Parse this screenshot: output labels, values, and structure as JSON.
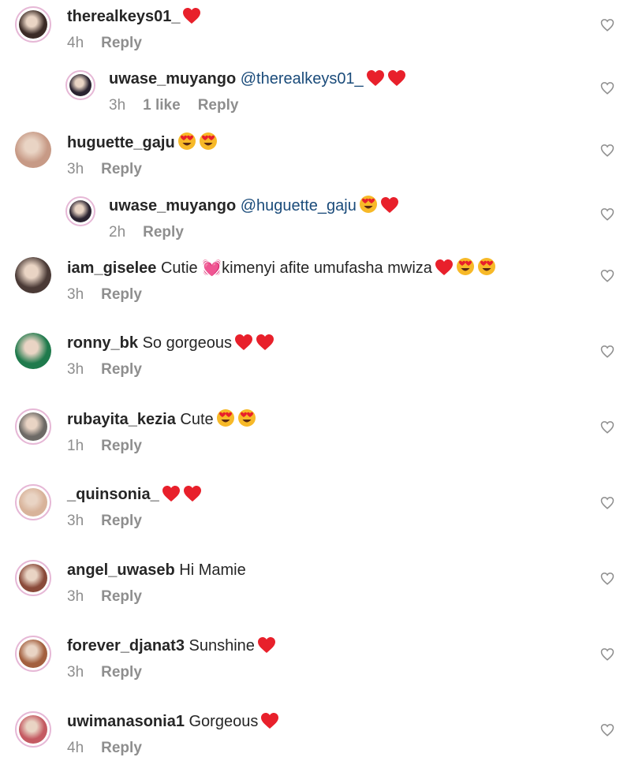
{
  "labels": {
    "reply": "Reply"
  },
  "icons": {
    "like": "heart-outline-icon"
  },
  "colors": {
    "username": "#262626",
    "meta": "#8e8e8e",
    "mention": "#1a4b7a",
    "heart": "#e8202b",
    "emoji_face": "#f7b928",
    "story_ring": "#e6b8d6"
  },
  "comments": [
    {
      "username": "therealkeys01_",
      "mention": "",
      "text": "",
      "emojis": [
        "heart"
      ],
      "time": "4h",
      "likes": "",
      "indent": false,
      "ring": true,
      "avatar_color": "#3b2b26"
    },
    {
      "username": "uwase_muyango",
      "mention": "@therealkeys01_",
      "text": "",
      "emojis": [
        "heart",
        "heart"
      ],
      "time": "3h",
      "likes": "1 like",
      "indent": true,
      "ring": true,
      "avatar_color": "#2a2330"
    },
    {
      "username": "huguette_gaju",
      "mention": "",
      "text": "",
      "emojis": [
        "heart-eyes",
        "heart-eyes"
      ],
      "time": "3h",
      "likes": "",
      "indent": false,
      "ring": false,
      "avatar_color": "#c79a86"
    },
    {
      "username": "uwase_muyango",
      "mention": "@huguette_gaju",
      "text": "",
      "emojis": [
        "heart-eyes",
        "heart"
      ],
      "time": "2h",
      "likes": "",
      "indent": true,
      "ring": true,
      "avatar_color": "#2a2330"
    },
    {
      "username": "iam_giselee",
      "mention": "",
      "text": "Cutie 💓kimenyi afite umufasha mwiza",
      "emojis": [
        "heart",
        "heart-eyes",
        "heart-eyes"
      ],
      "time": "3h",
      "likes": "",
      "indent": false,
      "ring": false,
      "avatar_color": "#4a3a36"
    },
    {
      "username": "ronny_bk",
      "mention": "",
      "text": "So gorgeous",
      "emojis": [
        "heart",
        "heart"
      ],
      "time": "3h",
      "likes": "",
      "indent": false,
      "ring": false,
      "avatar_color": "#1f7a4c"
    },
    {
      "username": "rubayita_kezia",
      "mention": "",
      "text": "Cute",
      "emojis": [
        "heart-eyes",
        "heart-eyes"
      ],
      "time": "1h",
      "likes": "",
      "indent": false,
      "ring": true,
      "avatar_color": "#6d6a66"
    },
    {
      "username": "_quinsonia_",
      "mention": "",
      "text": "",
      "emojis": [
        "heart",
        "heart"
      ],
      "time": "3h",
      "likes": "",
      "indent": false,
      "ring": true,
      "avatar_color": "#d8b39a"
    },
    {
      "username": "angel_uwaseb",
      "mention": "",
      "text": "Hi Mamie",
      "emojis": [],
      "time": "3h",
      "likes": "",
      "indent": false,
      "ring": true,
      "avatar_color": "#8a4a3a"
    },
    {
      "username": "forever_djanat3",
      "mention": "",
      "text": "Sunshine",
      "emojis": [
        "heart"
      ],
      "time": "3h",
      "likes": "",
      "indent": false,
      "ring": true,
      "avatar_color": "#a3603f"
    },
    {
      "username": "uwimanasonia1",
      "mention": "",
      "text": "Gorgeous",
      "emojis": [
        "heart"
      ],
      "time": "4h",
      "likes": "",
      "indent": false,
      "ring": true,
      "avatar_color": "#c45a62"
    }
  ]
}
